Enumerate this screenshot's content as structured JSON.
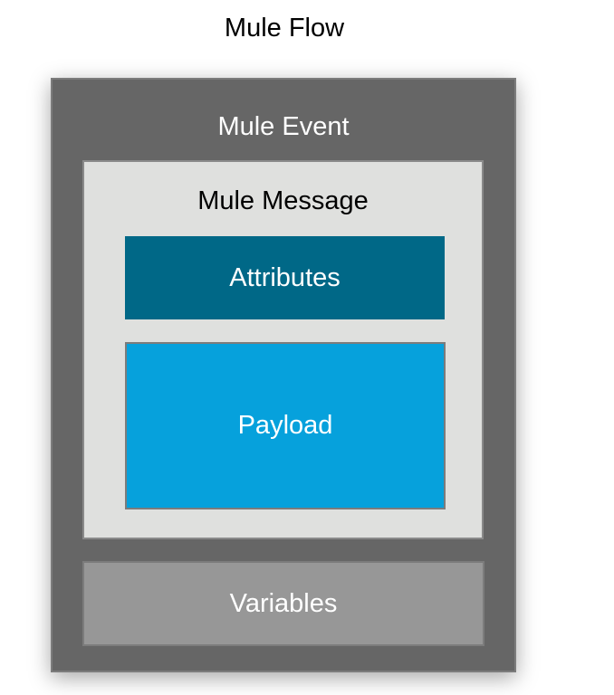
{
  "title": "Mule Flow",
  "event": {
    "label": "Mule Event",
    "color": "#666666"
  },
  "message": {
    "label": "Mule Message",
    "color": "#dfe0de"
  },
  "attributes": {
    "label": "Attributes",
    "color": "#006887"
  },
  "payload": {
    "label": "Payload",
    "color": "#06a1dc"
  },
  "variables": {
    "label": "Variables",
    "color": "#979797"
  }
}
